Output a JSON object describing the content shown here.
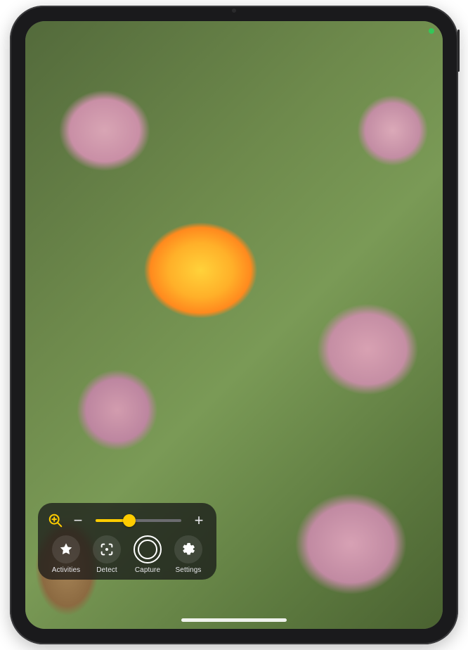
{
  "status": {
    "camera_active_color": "#34c759"
  },
  "panel": {
    "zoom": {
      "icon": "magnifier-plus-icon",
      "min_label": "−",
      "max_label": "+",
      "value_percent": 40
    },
    "tools": [
      {
        "id": "activities",
        "label": "Activities",
        "icon": "star-icon"
      },
      {
        "id": "detect",
        "label": "Detect",
        "icon": "detect-frame-icon"
      },
      {
        "id": "capture",
        "label": "Capture",
        "icon": "capture-ring-icon"
      },
      {
        "id": "settings",
        "label": "Settings",
        "icon": "gear-icon"
      }
    ]
  }
}
